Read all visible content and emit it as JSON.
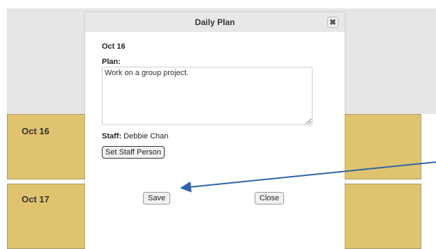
{
  "cards": [
    {
      "label": "Oct 16"
    },
    {
      "label": "Oct 17"
    }
  ],
  "dialog": {
    "title": "Daily Plan",
    "close_glyph": "✖",
    "date": "Oct 16",
    "plan_label": "Plan:",
    "plan_text": "Work on a group project.",
    "staff_label": "Staff:",
    "staff_name": "Debbie Chan",
    "set_staff_label": "Set Staff Person",
    "save_label": "Save",
    "close_label": "Close"
  },
  "colors": {
    "card_fill": "#e0c36f",
    "annotation_arrow": "#2f63a8"
  },
  "icons": {
    "dialog_close": "close-icon"
  }
}
